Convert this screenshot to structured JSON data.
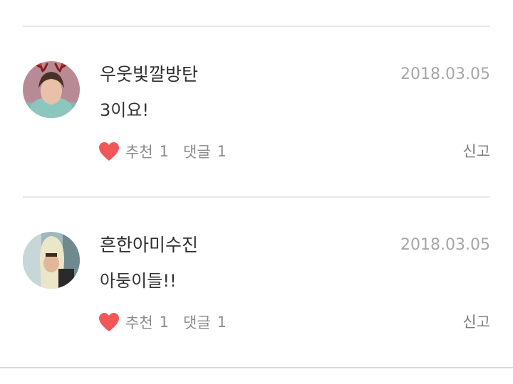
{
  "comments": [
    {
      "username": "우웃빛깔방탄",
      "date": "2018.03.05",
      "text": "3이요!",
      "like_label": "추천",
      "like_count": "1",
      "reply_label": "댓글",
      "reply_count": "1",
      "report_label": "신고",
      "avatar_icon": "avatar-photo-reindeer-antlers",
      "heart_icon": "heart-icon"
    },
    {
      "username": "흔한아미수진",
      "date": "2018.03.05",
      "text": "아둥이들!!",
      "like_label": "추천",
      "like_count": "1",
      "reply_label": "댓글",
      "reply_count": "1",
      "report_label": "신고",
      "avatar_icon": "avatar-photo-banana-costume",
      "heart_icon": "heart-icon"
    }
  ],
  "colors": {
    "heart": "#f25757",
    "divider": "#e7e7e7",
    "muted_text": "#a6a6a6"
  }
}
